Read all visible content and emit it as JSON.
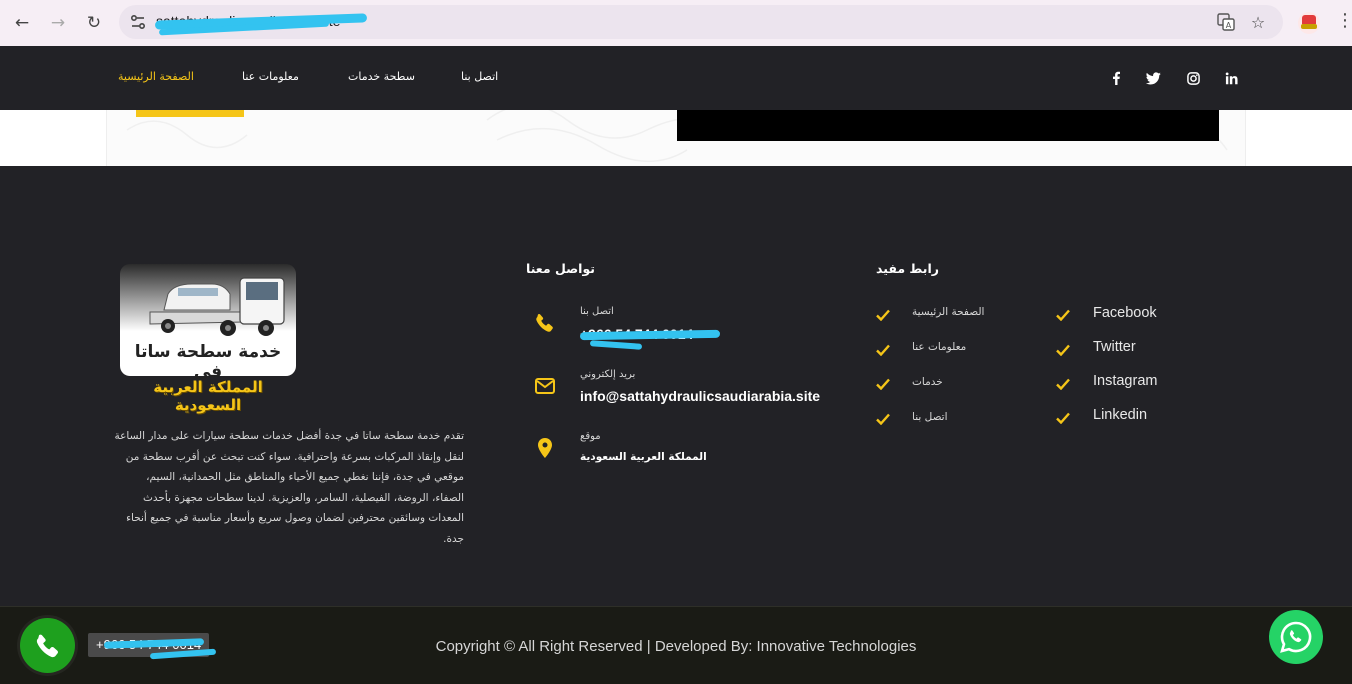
{
  "browser": {
    "url": "sattahydraulicsaudiarabia.site",
    "back_icon": "←",
    "forward_icon": "→",
    "reload_icon": "↻",
    "star_icon": "☆",
    "menu_icon": "⋮"
  },
  "navbar": {
    "links": [
      "الصفحة الرئيسية",
      "معلومات عنا",
      "سطحة خدمات",
      "اتصل بنا"
    ],
    "social": [
      "f",
      "t",
      "ig",
      "in"
    ]
  },
  "logo": {
    "line1": "خدمة سطحة ساتا في",
    "line2": "المملكة العربية السعودية"
  },
  "about": "تقدم خدمة سطحة ساتا في جدة أفضل خدمات سطحة سيارات على مدار الساعة لنقل وإنقاذ المركبات بسرعة واحترافية. سواء كنت تبحث عن أقرب سطحة من موقعي في جدة، فإننا نغطي جميع الأحياء والمناطق مثل الحمدانية، السيم، الصفاء، الروضة، الفيصلية، السامر، والعزيزية. لدينا سطحات مجهزة بأحدث المعدات وسائقين محترفين لضمان وصول سريع وأسعار مناسبة في جميع أنحاء جدة.",
  "contact": {
    "title": "تواصل معنا",
    "phone_label": "اتصل بنا",
    "phone_value": "+966 54 744 0014",
    "email_label": "بريد إلكتروني",
    "email_value": "info@sattahydraulicsaudiarabia.site",
    "location_label": "موقع",
    "location_value": "المملكة العربية السعودية"
  },
  "useful_links": {
    "title": "رابط مفيد",
    "arabic": [
      "الصفحة الرئيسية",
      "معلومات عنا",
      "خدمات",
      "اتصل بنا"
    ],
    "english": [
      "Facebook",
      "Twitter",
      "Instagram",
      "Linkedin"
    ]
  },
  "bottom": {
    "copyright": "Copyright © All Right Reserved | Developed By: Innovative Technologies",
    "call_number": "+966 54 744 0014"
  },
  "colors": {
    "accent": "#f5c518",
    "dark": "#222226",
    "call_green": "#1ea01e",
    "whatsapp": "#25d366"
  }
}
